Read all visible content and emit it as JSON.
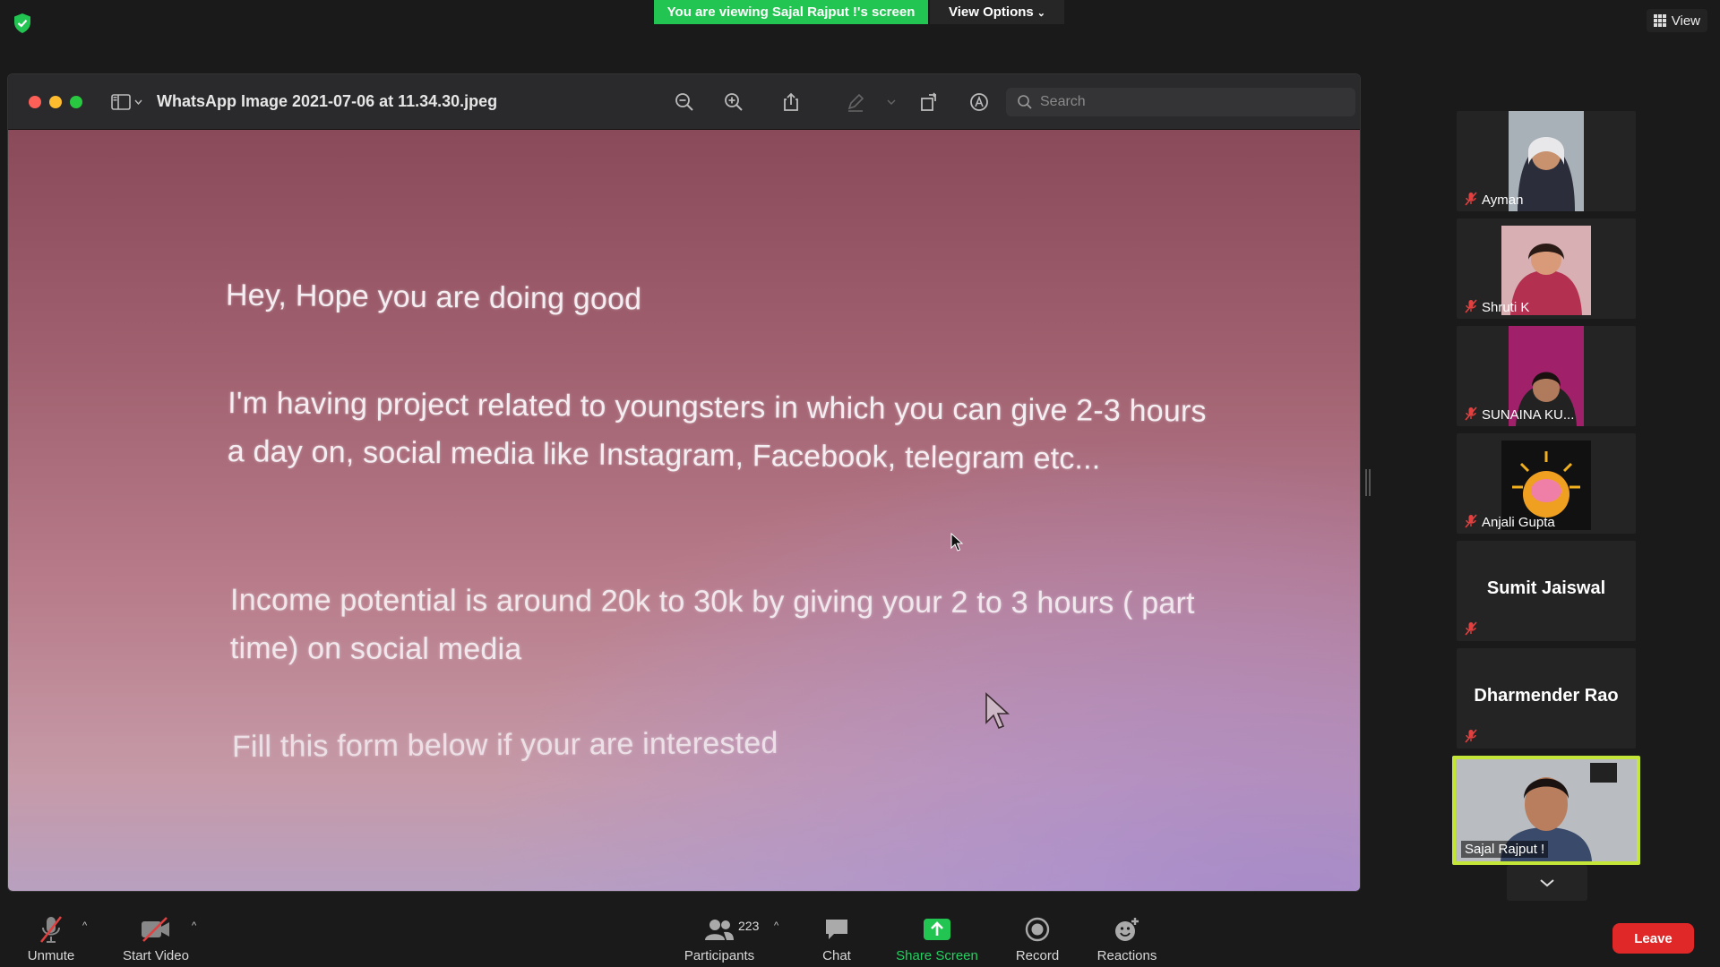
{
  "banner": {
    "viewing": "You are viewing Sajal Rajput !'s screen",
    "view_options": "View Options"
  },
  "top_right": {
    "view_label": "View"
  },
  "shared_window": {
    "title": "WhatsApp Image 2021-07-06 at 11.34.30.jpeg",
    "search_placeholder": "Search",
    "message": {
      "line1": "Hey, Hope you are doing good",
      "line2": "I'm having project related to youngsters in which you can give 2-3 hours a day on, social media like Instagram, Facebook, telegram etc...",
      "line3": "Income potential is around 20k to 30k by giving your 2 to 3 hours ( part time) on social media",
      "line4": "Fill this form below if your are interested"
    }
  },
  "participants": [
    {
      "name": "Ayman",
      "type": "photo",
      "color": "#9aa3ad"
    },
    {
      "name": "Shruti K",
      "type": "photo",
      "color": "#d9a2a6"
    },
    {
      "name": "SUNAINA KU...",
      "type": "photo",
      "color": "#a0216a"
    },
    {
      "name": "Anjali Gupta",
      "type": "photo",
      "color": "#111111"
    },
    {
      "name": "Sumit Jaiswal",
      "type": "name"
    },
    {
      "name": "Dharmender Rao",
      "type": "name"
    },
    {
      "name": "Sajal Rajput !",
      "type": "video",
      "active": true
    }
  ],
  "toolbar": {
    "unmute": "Unmute",
    "start_video": "Start Video",
    "participants": "Participants",
    "participants_count": "223",
    "chat": "Chat",
    "share_screen": "Share Screen",
    "record": "Record",
    "reactions": "Reactions",
    "leave": "Leave"
  },
  "colors": {
    "share_green": "#23c552",
    "leave_red": "#e02828",
    "active_speaker": "#c4e639"
  }
}
